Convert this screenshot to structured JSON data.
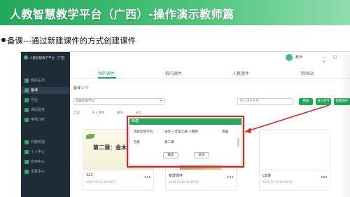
{
  "slide": {
    "title": "人教智慧教学平台（广西）-操作演示教师篇",
    "bullet": "备课---通过新建课件的方式创建课件"
  },
  "app": {
    "logo_text": "人教智慧教学平台（广西）",
    "sidebar": {
      "items": [
        {
          "label": "我的主页",
          "icon": "home-icon"
        },
        {
          "label": "备课",
          "icon": "book-icon"
        },
        {
          "label": "作业",
          "icon": "homework-icon"
        },
        {
          "label": "课后服务",
          "icon": "service-icon"
        },
        {
          "label": "学情分析",
          "icon": "analysis-icon"
        },
        {
          "label": "外部资源",
          "icon": "resource-icon"
        },
        {
          "label": "个人中心",
          "icon": "user-icon"
        },
        {
          "label": "应用中心",
          "icon": "apps-icon"
        },
        {
          "label": "设置中心",
          "icon": "settings-icon"
        }
      ]
    },
    "topbar": {
      "user_name": "教师",
      "window_controls": "— □ ×"
    },
    "tabs": [
      "我的课件",
      "校内课件",
      "人教课件",
      "回收站"
    ],
    "subline": {
      "prefix": "备课",
      "count": "1",
      "suffix": "个"
    },
    "filters": {
      "grade_select": "选择年级学科",
      "search_placeholder": "输入课件名称",
      "search_button": "搜索",
      "import_button": "导入PPT",
      "new_button": "新建课件"
    },
    "tools": [
      "全选",
      "导入课件",
      "删除",
      "分享"
    ],
    "cards": [
      {
        "thumb_title": "第二课：金木",
        "name": "123",
        "date": "2020-10-12 09:46:53"
      },
      {
        "thumb_title": "",
        "name": "新建课件",
        "date": "2020-10-12 09:46:53"
      },
      {
        "thumb_title": "",
        "name": "CB课",
        "date": "2020-10-12 09:46:53"
      }
    ],
    "dialog": {
      "title": "新建",
      "label_grade": "选择年级学科",
      "value_grade": "语文 一年级上册 人教版",
      "value_version": "统编",
      "label_name": "名称",
      "value_name": "第二课",
      "confirm_button": "确定",
      "cancel_button": "取消"
    }
  },
  "colors": {
    "accent": "#26a65b",
    "sidebar_bg": "#1f2b36",
    "highlight_frame": "#e02424"
  }
}
